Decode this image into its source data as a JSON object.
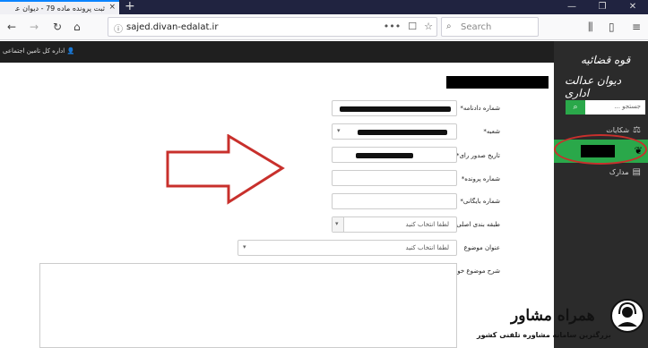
{
  "browser": {
    "tab_title": "ثبت پرونده ماده 79 - دیوان عدال...",
    "tab_close": "×",
    "new_tab": "+",
    "window_controls": [
      "—",
      "❐",
      "✕"
    ],
    "url": "sajed.divan-edalat.ir",
    "url_actions": [
      "•••",
      "☐",
      "☆"
    ],
    "search_placeholder": "Search"
  },
  "site": {
    "user_label": "اداره کل تامین اجتماعی",
    "logo_line1": "قوه قضائیه",
    "logo_line2": "دیوان عدالت اداری"
  },
  "sidebar": {
    "search_placeholder": "جستجو ...",
    "items": [
      {
        "label": "شکایات",
        "icon": "scales-icon"
      },
      {
        "label": "",
        "icon": "leaf-icon",
        "active": true
      },
      {
        "label": "مدارک",
        "icon": "documents-icon"
      }
    ]
  },
  "form": {
    "fields": [
      {
        "label": "شماره دادنامه*"
      },
      {
        "label": "شعبه*"
      },
      {
        "label": "تاریخ صدور رای*"
      },
      {
        "label": "شماره پرونده*"
      },
      {
        "label": "شماره بایگانی*"
      },
      {
        "label": "طبقه بندی اصلی موضوع",
        "placeholder": "لطفا انتخاب کنید"
      },
      {
        "label": "عنوان موضوع",
        "placeholder": "لطفا انتخاب کنید"
      },
      {
        "label": "شرح موضوع خواسته"
      }
    ]
  },
  "watermark": {
    "title": "همراه مشاور",
    "subtitle": "بزرگترین سامانه مشاوره تلفنی کشور"
  },
  "colors": {
    "accent_green": "#2aa84a",
    "annotation_red": "#c8302c",
    "sidebar_bg": "#2b2b2b"
  }
}
